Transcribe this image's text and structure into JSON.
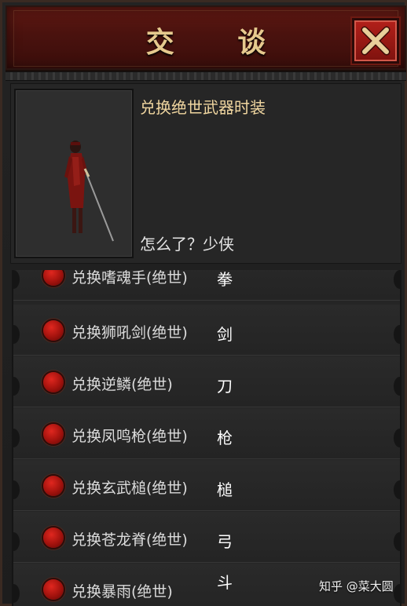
{
  "dialog": {
    "title": "交 谈",
    "close_icon": "close-x-icon"
  },
  "npc": {
    "name": "兑换绝世武器时装",
    "greeting": "怎么了？少侠"
  },
  "options": [
    {
      "label": "兑换嗜魂手(绝世)",
      "type": "拳"
    },
    {
      "label": "兑换狮吼剑(绝世)",
      "type": "剑"
    },
    {
      "label": "兑换逆鳞(绝世)",
      "type": "刀"
    },
    {
      "label": "兑换凤鸣枪(绝世)",
      "type": "枪"
    },
    {
      "label": "兑换玄武槌(绝世)",
      "type": "槌"
    },
    {
      "label": "兑换苍龙脊(绝世)",
      "type": "弓"
    },
    {
      "label": "兑换暴雨(绝世)",
      "type": "斗"
    }
  ],
  "watermark": "知乎 @菜大圆",
  "colors": {
    "header_red": "#4a120e",
    "title_gold": "#e6c98e",
    "bullet_red": "#c41a14",
    "close_button_red": "#a01a14"
  }
}
